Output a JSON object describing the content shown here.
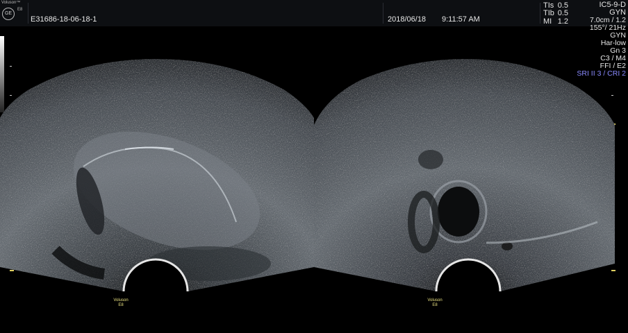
{
  "header": {
    "brand": "Voluson™",
    "model_small": "E8",
    "logo_text": "GE",
    "patient_id": "E31686-18-06-18-1",
    "date": "2018/06/18",
    "time": "9:11:57 AM",
    "indices": [
      {
        "label": "TIs",
        "value": "0.5"
      },
      {
        "label": "TIb",
        "value": "0.5"
      },
      {
        "label": "MI",
        "value": "1.2"
      }
    ],
    "probe": "IC5-9-D",
    "app": "GYN"
  },
  "settings": [
    "7.0cm / 1.2",
    "155°/ 21Hz",
    "GYN",
    "Har-low",
    "Gn  3",
    "C3 / M4",
    "FFI / E2"
  ],
  "settings_highlight": "SRI II 3 / CRI 2",
  "left_label": {
    "line1": "Voluson",
    "line2": "E8"
  },
  "right_label": {
    "line1": "Voluson",
    "line2": "E8"
  },
  "colors": {
    "highlight": "#8a8aff",
    "marker": "#e0d060"
  }
}
